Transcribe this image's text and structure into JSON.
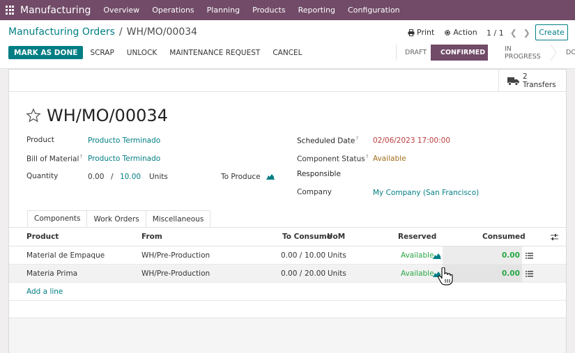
{
  "topnav": {
    "app_name": "Manufacturing",
    "items": [
      "Overview",
      "Operations",
      "Planning",
      "Products",
      "Reporting",
      "Configuration"
    ]
  },
  "breadcrumb": {
    "parent": "Manufacturing Orders",
    "separator": "/",
    "current": "WH/MO/00034"
  },
  "toolbar": {
    "print": "Print",
    "action": "Action",
    "pager": "1 / 1",
    "create": "Create"
  },
  "actions": {
    "mark_done": "MARK AS DONE",
    "scrap": "SCRAP",
    "unlock": "UNLOCK",
    "maintenance": "MAINTENANCE REQUEST",
    "cancel": "CANCEL"
  },
  "status": {
    "draft": "DRAFT",
    "confirmed": "CONFIRMED",
    "in_progress": "IN PROGRESS",
    "done": "DONE"
  },
  "stat": {
    "count": "2",
    "label": "Transfers"
  },
  "record": {
    "name": "WH/MO/00034"
  },
  "fields": {
    "product_label": "Product",
    "product_value": "Producto Terminado",
    "bom_label": "Bill of Material",
    "bom_value": "Producto Terminado",
    "qty_label": "Quantity",
    "qty_value": "0.00",
    "qty_sep": "/",
    "qty_total": "10.00",
    "qty_uom": "Units",
    "to_produce": "To Produce",
    "sched_label": "Scheduled Date",
    "sched_value": "02/06/2023 17:00:00",
    "comp_label": "Component Status",
    "comp_value": "Available",
    "resp_label": "Responsible",
    "company_label": "Company",
    "company_value": "My Company (San Francisco)",
    "help_mark": "?"
  },
  "tabs": [
    "Components",
    "Work Orders",
    "Miscellaneous"
  ],
  "table": {
    "headers": {
      "product": "Product",
      "from": "From",
      "to_consume": "To Consume",
      "uom": "UoM",
      "reserved": "Reserved",
      "consumed": "Consumed"
    },
    "rows": [
      {
        "product": "Material de Empaque",
        "from": "WH/Pre-Production",
        "qty": "0.00 /",
        "total": "10.00",
        "uom": "Units",
        "reserved": "Available",
        "consumed": "0.00"
      },
      {
        "product": "Materia Prima",
        "from": "WH/Pre-Production",
        "qty": "0.00 /",
        "total": "20.00",
        "uom": "Units",
        "reserved": "Available",
        "consumed": "0.00"
      }
    ],
    "add_line": "Add a line"
  },
  "colors": {
    "brand": "#714b67",
    "accent": "#017e84",
    "success": "#28a745",
    "danger": "#b83c3c"
  }
}
